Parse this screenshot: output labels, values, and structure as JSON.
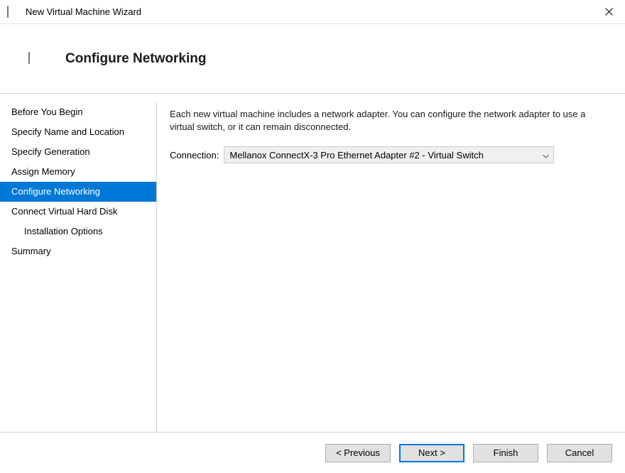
{
  "window": {
    "title": "New Virtual Machine Wizard"
  },
  "header": {
    "title": "Configure Networking"
  },
  "sidebar": {
    "items": [
      {
        "label": "Before You Begin",
        "selected": false,
        "indented": false
      },
      {
        "label": "Specify Name and Location",
        "selected": false,
        "indented": false
      },
      {
        "label": "Specify Generation",
        "selected": false,
        "indented": false
      },
      {
        "label": "Assign Memory",
        "selected": false,
        "indented": false
      },
      {
        "label": "Configure Networking",
        "selected": true,
        "indented": false
      },
      {
        "label": "Connect Virtual Hard Disk",
        "selected": false,
        "indented": false
      },
      {
        "label": "Installation Options",
        "selected": false,
        "indented": true
      },
      {
        "label": "Summary",
        "selected": false,
        "indented": false
      }
    ]
  },
  "content": {
    "description": "Each new virtual machine includes a network adapter. You can configure the network adapter to use a virtual switch, or it can remain disconnected.",
    "connection_label": "Connection:",
    "connection_value": "Mellanox ConnectX-3 Pro Ethernet Adapter #2 - Virtual Switch"
  },
  "footer": {
    "previous": "< Previous",
    "next": "Next >",
    "finish": "Finish",
    "cancel": "Cancel"
  }
}
